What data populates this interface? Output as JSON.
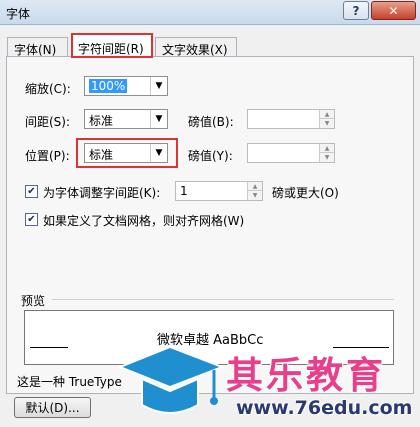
{
  "window": {
    "title": "字体",
    "help_label": "?",
    "close_label": "✕"
  },
  "tabs": [
    {
      "label": "字体(N)",
      "active": false
    },
    {
      "label": "字符间距(R)",
      "active": true
    },
    {
      "label": "文字效果(X)",
      "active": false
    }
  ],
  "spacing": {
    "scale_label": "缩放(C):",
    "scale_value": "100%",
    "spacing_label": "间距(S):",
    "spacing_value": "标准",
    "spacing_by_label": "磅值(B):",
    "spacing_by_value": "",
    "position_label": "位置(P):",
    "position_value": "标准",
    "position_by_label": "磅值(Y):",
    "position_by_value": "",
    "kerning_label": "为字体调整字间距(K):",
    "kerning_checked": true,
    "kerning_value": "1",
    "kerning_suffix": "磅或更大(O)",
    "grid_label": "如果定义了文档网格，则对齐网格(W)",
    "grid_checked": true
  },
  "preview": {
    "label": "预览",
    "text": "微软卓越  AaBbCc",
    "description": "这是一种 TrueType"
  },
  "buttons": {
    "default_label": "默认(D)..."
  },
  "watermark": {
    "brand": "其乐教育",
    "url": "www.76edu.com",
    "icon": "graduation-cap-icon"
  },
  "colors": {
    "highlight_border": "#dd3333",
    "brand_pink": "#e83f8a",
    "brand_blue": "#2a3970"
  }
}
